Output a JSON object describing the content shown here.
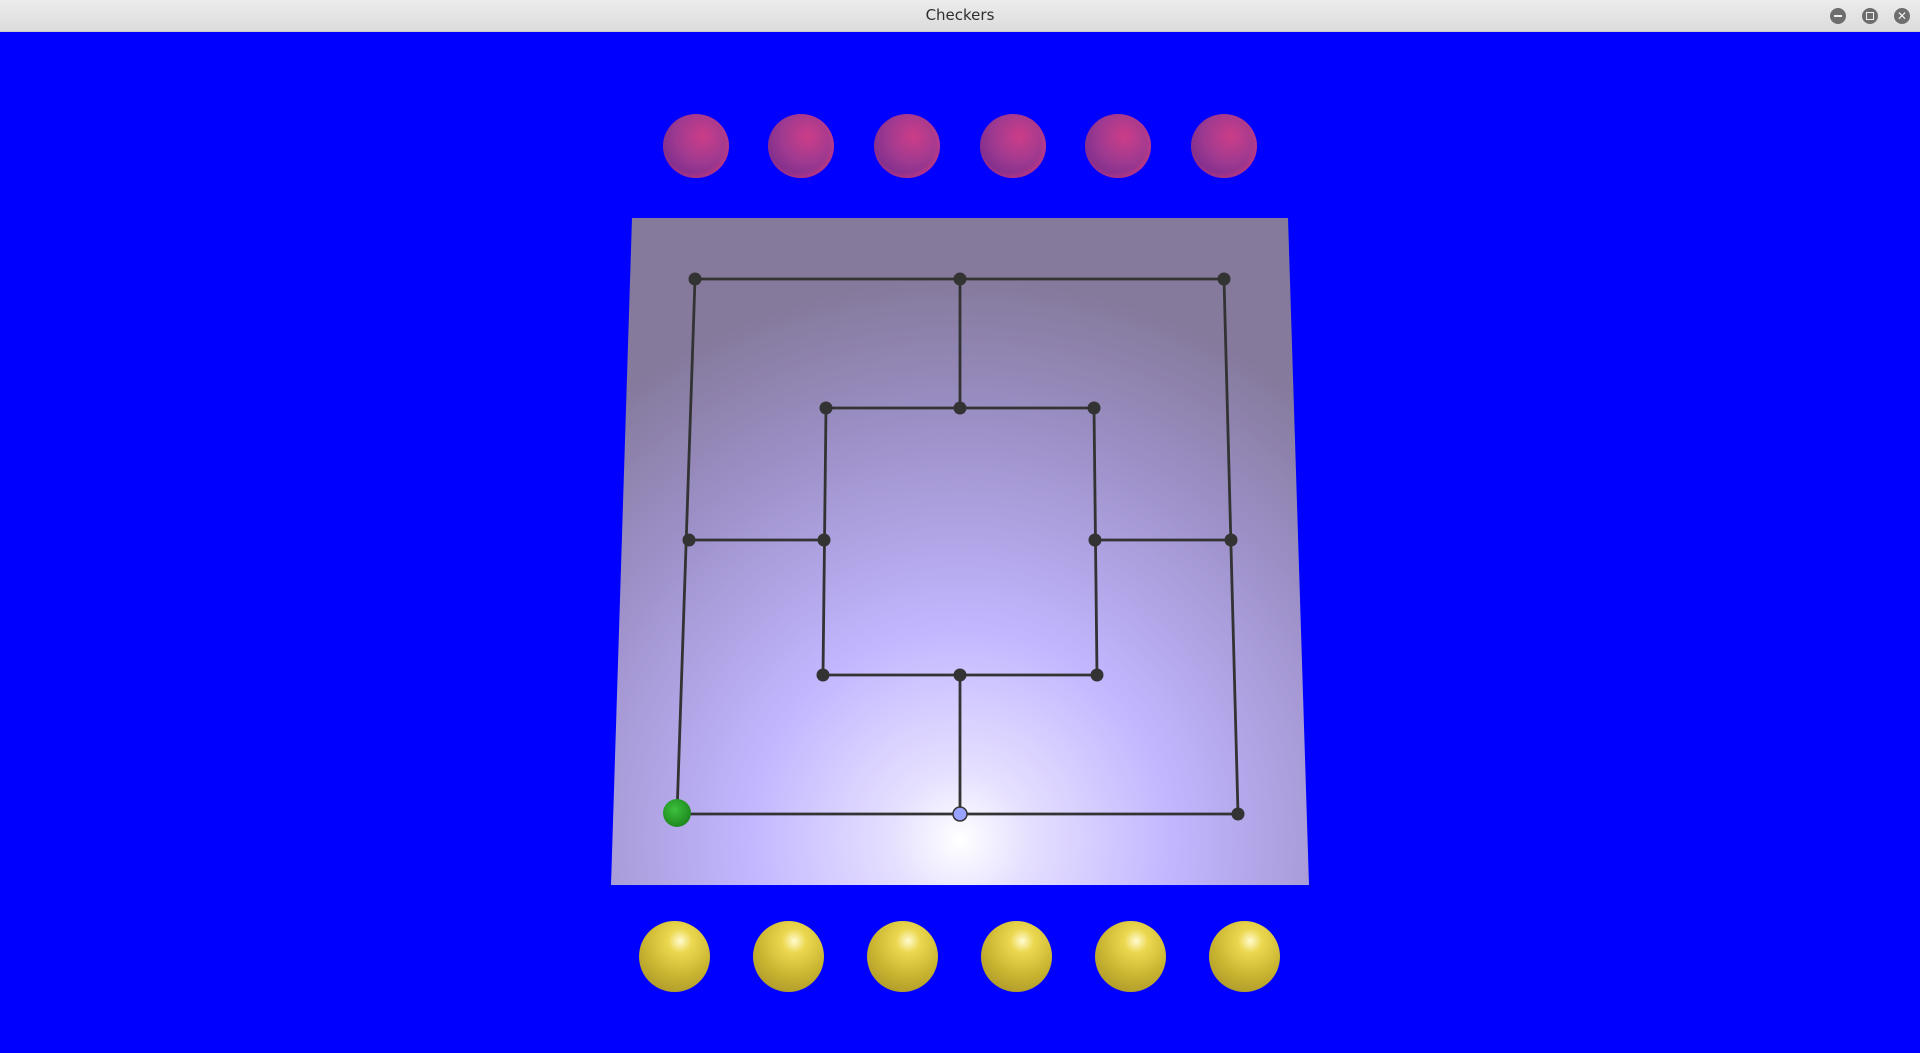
{
  "window": {
    "title": "Checkers",
    "buttons": {
      "minimize": "minimize-icon",
      "maximize": "maximize-icon",
      "close": "close-icon"
    }
  },
  "colors": {
    "background": "#0000ff",
    "board_edge": "#8a7ea0",
    "board_center": "#c4b8ff",
    "line": "#333333",
    "node": "#333333",
    "red_piece": "#a03a90",
    "yellow_piece": "#d4c03a",
    "selected_piece": "#2a9d2a",
    "highlight_node": "#9aa2ff"
  },
  "game": {
    "board_type": "nine men's morris",
    "red_reserve_count": 6,
    "yellow_reserve_count": 6,
    "placed_pieces": [
      {
        "color": "green",
        "point": "outer-bottom-left"
      }
    ],
    "highlighted_point": "outer-bottom-middle"
  }
}
